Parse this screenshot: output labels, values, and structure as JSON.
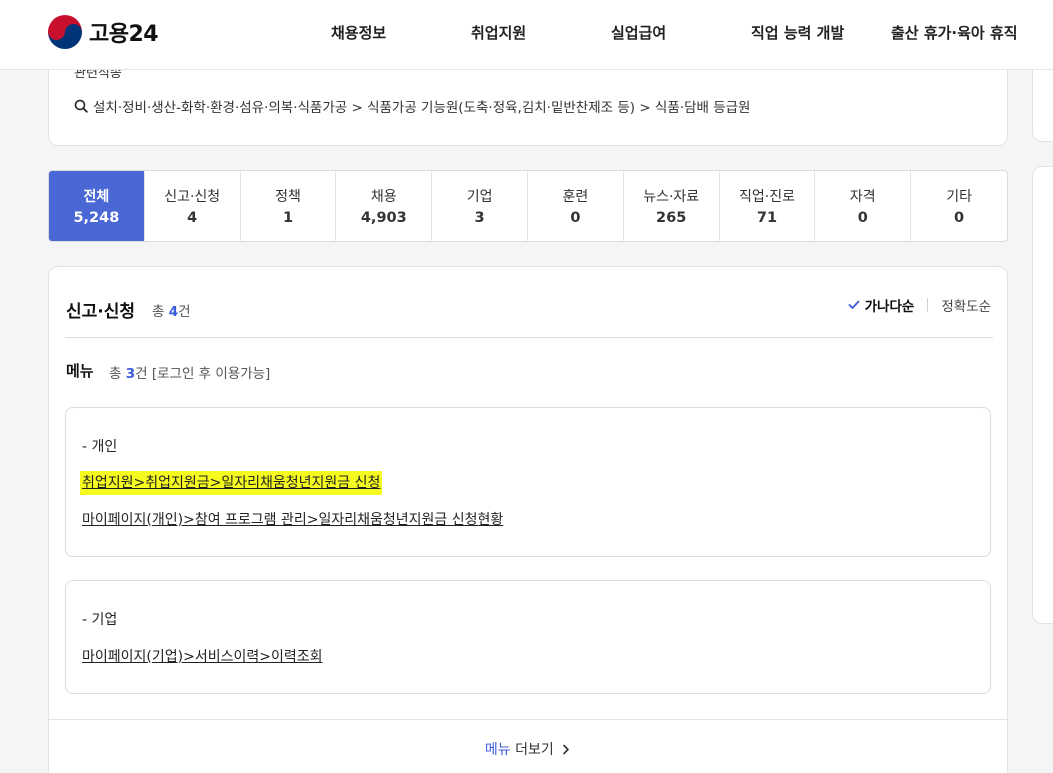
{
  "header": {
    "logo_text": "고용24",
    "nav": [
      "채용정보",
      "취업지원",
      "실업급여",
      "직업 능력 개발",
      "출산 휴가·육아 휴직"
    ]
  },
  "related": {
    "label": "관련직종",
    "path": "설치·정비·생산-화학·환경·섬유·의복·식품가공 > 식품가공 기능원(도축·정육,김치·밑반찬제조 등) > 식품·담배 등급원"
  },
  "tabs": [
    {
      "label": "전체",
      "count": "5,248",
      "active": true
    },
    {
      "label": "신고·신청",
      "count": "4"
    },
    {
      "label": "정책",
      "count": "1"
    },
    {
      "label": "채용",
      "count": "4,903"
    },
    {
      "label": "기업",
      "count": "3"
    },
    {
      "label": "훈련",
      "count": "0"
    },
    {
      "label": "뉴스·자료",
      "count": "265"
    },
    {
      "label": "직업·진로",
      "count": "71"
    },
    {
      "label": "자격",
      "count": "0"
    },
    {
      "label": "기타",
      "count": "0"
    }
  ],
  "section": {
    "title": "신고·신청",
    "count_prefix": "총",
    "count": "4",
    "count_suffix": "건",
    "sort_active": "가나다순",
    "sort_other": "정확도순"
  },
  "menu": {
    "title": "메뉴",
    "count_prefix": "총",
    "count": "3",
    "count_suffix": "건 [로그인 후 이용가능]"
  },
  "groups": [
    {
      "title": "- 개인",
      "links": [
        "취업지원>취업지원금>일자리채움청년지원금 신청",
        "마이페이지(개인)>참여 프로그램 관리>일자리채움청년지원금 신청현황"
      ]
    },
    {
      "title": "- 기업",
      "links": [
        "마이페이지(기업)>서비스이력>이력조회"
      ]
    }
  ],
  "more": {
    "accent": "메뉴",
    "rest": "더보기"
  },
  "colors": {
    "accent": "#4a67d6",
    "highlight": "#f6fb1f",
    "count": "#3a5bd9"
  }
}
